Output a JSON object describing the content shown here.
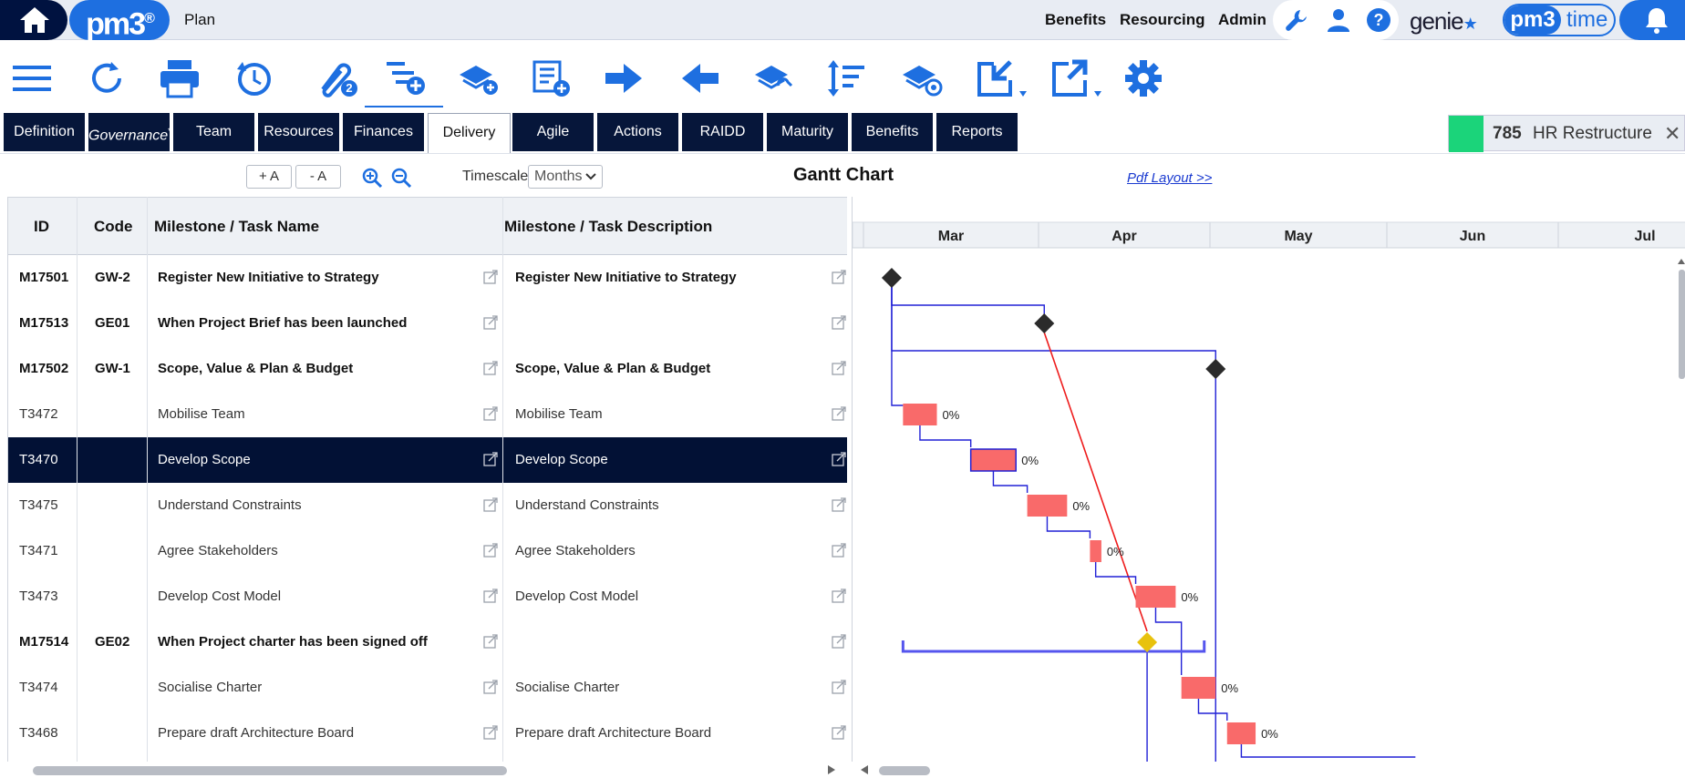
{
  "header": {
    "logo": "pm3",
    "page_title": "Plan",
    "nav": [
      "Benefits",
      "Resourcing",
      "Admin"
    ],
    "genie": "genie",
    "pm3time_logo": "pm3",
    "pm3time_label": "time"
  },
  "toolbar": {
    "icons": [
      "menu-icon",
      "refresh-icon",
      "print-icon",
      "history-icon",
      "attachment-icon",
      "add-task-icon",
      "add-milestone-icon",
      "add-note-icon",
      "indent-right-icon",
      "outdent-left-icon",
      "link-milestone-icon",
      "sort-icon",
      "view-milestone-icon",
      "import-icon",
      "export-icon",
      "settings-icon"
    ],
    "attachment_count": "2"
  },
  "tabs": [
    "Definition",
    "Governance",
    "Team",
    "Resources",
    "Finances",
    "Delivery",
    "Agile",
    "Actions",
    "RAIDD",
    "Maturity",
    "Benefits",
    "Reports"
  ],
  "active_tab": "Delivery",
  "governance_marker": "*",
  "project": {
    "number": "785",
    "name": "HR Restructure"
  },
  "options": {
    "font_up": "+ A",
    "font_down": "- A",
    "timescale_label": "Timescale",
    "timescale_value": "Months",
    "gantt_title": "Gantt Chart",
    "pdf_link": "Pdf Layout >>"
  },
  "columns": [
    "ID",
    "Code",
    "Milestone / Task Name",
    "Milestone / Task Description"
  ],
  "rows": [
    {
      "id": "M17501",
      "code": "GW-2",
      "name": "Register New Initiative to Strategy",
      "desc": "Register New Initiative to Strategy",
      "milestone": true
    },
    {
      "id": "M17513",
      "code": "GE01",
      "name": "When Project Brief has been launched",
      "desc": "",
      "milestone": true
    },
    {
      "id": "M17502",
      "code": "GW-1",
      "name": "Scope, Value & Plan & Budget",
      "desc": "Scope, Value & Plan & Budget",
      "milestone": true
    },
    {
      "id": "T3472",
      "code": "",
      "name": "Mobilise Team",
      "desc": "Mobilise Team",
      "milestone": false
    },
    {
      "id": "T3470",
      "code": "",
      "name": "Develop Scope",
      "desc": "Develop Scope",
      "milestone": false,
      "selected": true
    },
    {
      "id": "T3475",
      "code": "",
      "name": "Understand Constraints",
      "desc": "Understand Constraints",
      "milestone": false
    },
    {
      "id": "T3471",
      "code": "",
      "name": "Agree Stakeholders",
      "desc": "Agree Stakeholders",
      "milestone": false
    },
    {
      "id": "T3473",
      "code": "",
      "name": "Develop Cost Model",
      "desc": "Develop Cost Model",
      "milestone": false
    },
    {
      "id": "M17514",
      "code": "GE02",
      "name": "When Project charter has been signed off",
      "desc": "",
      "milestone": true
    },
    {
      "id": "T3474",
      "code": "",
      "name": "Socialise Charter",
      "desc": "Socialise Charter",
      "milestone": false
    },
    {
      "id": "T3468",
      "code": "",
      "name": "Prepare draft Architecture Board",
      "desc": "Prepare draft Architecture Board",
      "milestone": false
    }
  ],
  "gantt": {
    "months": [
      "Mar",
      "Apr",
      "May",
      "Jun",
      "Jul"
    ],
    "tasks": [
      {
        "row": 0,
        "type": "milestone",
        "date": "Mar 6"
      },
      {
        "row": 1,
        "type": "milestone",
        "date": "Apr 2"
      },
      {
        "row": 2,
        "type": "milestone",
        "date": "May 2"
      },
      {
        "row": 3,
        "type": "task",
        "start": "Mar 8",
        "end": "Mar 14",
        "progress": "0%"
      },
      {
        "row": 4,
        "type": "task",
        "start": "Mar 20",
        "end": "Mar 28",
        "progress": "0%"
      },
      {
        "row": 5,
        "type": "task",
        "start": "Mar 30",
        "end": "Apr 6",
        "progress": "0%"
      },
      {
        "row": 6,
        "type": "task",
        "start": "Apr 10",
        "end": "Apr 12",
        "progress": "0%"
      },
      {
        "row": 7,
        "type": "task",
        "start": "Apr 18",
        "end": "Apr 25",
        "progress": "0%"
      },
      {
        "row": 8,
        "type": "milestone",
        "date": "Apr 20",
        "color": "#e8c20e"
      },
      {
        "row": 9,
        "type": "task",
        "start": "Apr 26",
        "end": "May 2",
        "progress": "0%"
      },
      {
        "row": 10,
        "type": "task",
        "start": "May 4",
        "end": "May 9",
        "progress": "0%"
      }
    ],
    "colors": {
      "task": "#f96a6a",
      "milestone": "#2b2b2b",
      "link": "#2121d6",
      "critical": "#ee1c1c",
      "summary": "#5555ee"
    }
  }
}
